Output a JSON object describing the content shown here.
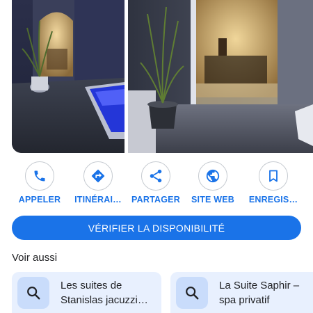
{
  "actions": [
    {
      "label": "APPELER",
      "icon": "phone-icon"
    },
    {
      "label": "ITINÉRAI…",
      "icon": "directions-icon"
    },
    {
      "label": "PARTAGER",
      "icon": "share-icon"
    },
    {
      "label": "SITE WEB",
      "icon": "globe-icon"
    },
    {
      "label": "ENREGIS…",
      "icon": "bookmark-icon"
    }
  ],
  "availability_button": "VÉRIFIER LA DISPONIBILITÉ",
  "see_also": {
    "title": "Voir aussi",
    "cards": [
      {
        "line1": "Les suites de",
        "line2": "Stanislas jacuzzi…",
        "icon": "search-icon"
      },
      {
        "line1": "La Suite Saphir –",
        "line2": "spa privatif",
        "icon": "search-icon"
      }
    ]
  },
  "colors": {
    "accent": "#1a73e8",
    "card_bg": "#e8f0fe",
    "icon_bg": "#c9dcfb"
  }
}
